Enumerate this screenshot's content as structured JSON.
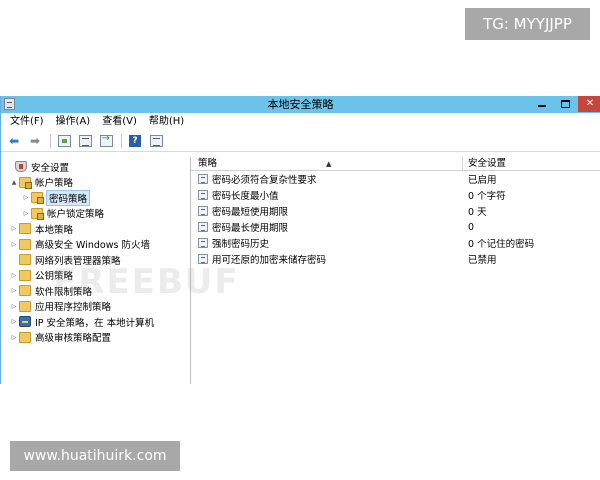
{
  "overlays": {
    "tg": "TG: MYYJJPP",
    "site": "www.huatihuirk.com",
    "watermark": "FREEBUF"
  },
  "window": {
    "title": "本地安全策略",
    "buttons": {
      "minimize": "minimize",
      "maximize": "maximize",
      "close": "✕"
    }
  },
  "menu": {
    "items": [
      "文件(F)",
      "操作(A)",
      "查看(V)",
      "帮助(H)"
    ]
  },
  "toolbar": {
    "icons": [
      "back-arrow-icon",
      "forward-arrow-icon",
      "up-folder-icon",
      "show-hide-tree-icon",
      "export-list-icon",
      "help-icon",
      "properties-icon"
    ],
    "help_glyph": "?"
  },
  "tree": {
    "items": [
      {
        "label": "安全设置",
        "level": 0,
        "expander": "",
        "icon": "shield-icon"
      },
      {
        "label": "帐户策略",
        "level": 1,
        "expander": "▲",
        "icon": "folder-icon"
      },
      {
        "label": "密码策略",
        "level": 2,
        "expander": "▷",
        "icon": "folder-icon",
        "selected": true
      },
      {
        "label": "帐户锁定策略",
        "level": 2,
        "expander": "▷",
        "icon": "folder-icon"
      },
      {
        "label": "本地策略",
        "level": 1,
        "expander": "▷",
        "icon": "folder-icon"
      },
      {
        "label": "高级安全 Windows 防火墙",
        "level": 1,
        "expander": "▷",
        "icon": "folder-icon"
      },
      {
        "label": "网络列表管理器策略",
        "level": 1,
        "expander": "",
        "icon": "folder-icon"
      },
      {
        "label": "公钥策略",
        "level": 1,
        "expander": "▷",
        "icon": "folder-icon"
      },
      {
        "label": "软件限制策略",
        "level": 1,
        "expander": "▷",
        "icon": "folder-icon"
      },
      {
        "label": "应用程序控制策略",
        "level": 1,
        "expander": "▷",
        "icon": "folder-icon"
      },
      {
        "label": "IP 安全策略，在 本地计算机",
        "level": 1,
        "expander": "▷",
        "icon": "ipsec-icon"
      },
      {
        "label": "高级审核策略配置",
        "level": 1,
        "expander": "▷",
        "icon": "folder-icon"
      }
    ]
  },
  "list": {
    "columns": {
      "policy": "策略",
      "setting": "安全设置"
    },
    "rows": [
      {
        "policy": "密码必须符合复杂性要求",
        "setting": "已启用"
      },
      {
        "policy": "密码长度最小值",
        "setting": "0 个字符"
      },
      {
        "policy": "密码最短使用期限",
        "setting": "0 天"
      },
      {
        "policy": "密码最长使用期限",
        "setting": "0"
      },
      {
        "policy": "强制密码历史",
        "setting": "0 个记住的密码"
      },
      {
        "policy": "用可还原的加密来储存密码",
        "setting": "已禁用"
      }
    ]
  }
}
